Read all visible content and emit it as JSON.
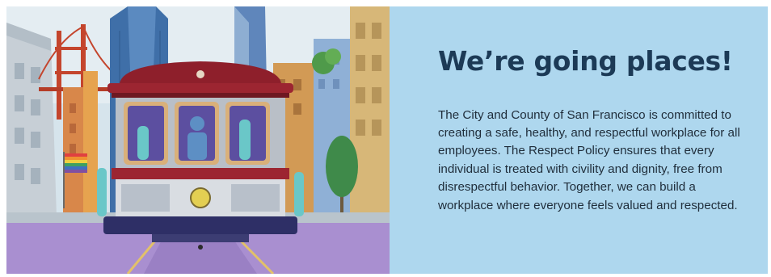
{
  "banner": {
    "headline": "We’re going places!",
    "body": "The City and County of San Francisco is committed to creating a safe, healthy, and respectful workplace for all employees. The Respect Policy ensures that every individual is treated with civility and dignity, free from disrespectful behavior. Together, we can build a workplace where everyone feels valued and respected.",
    "illustration": {
      "subject": "cable-car-illustration",
      "icons": [
        "golden-gate-bridge-icon",
        "skyscraper-icon",
        "cable-car-icon",
        "pride-flag-icon",
        "tree-icon"
      ]
    }
  },
  "colors": {
    "panel_background": "#aed7ee",
    "headline": "#1c3a56",
    "body_text": "#1f2d3a",
    "cable_car_red": "#8e1f2b",
    "street_purple": "#a98fd0"
  }
}
